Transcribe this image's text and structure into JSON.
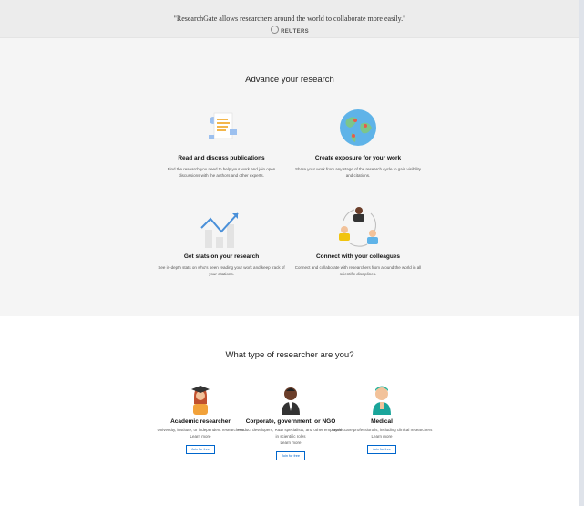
{
  "quote_bar": {
    "quote": "\"ResearchGate allows researchers around the world to collaborate more easily.\"",
    "source": "REUTERS"
  },
  "advance": {
    "title": "Advance your research",
    "features": [
      {
        "title": "Read and discuss publications",
        "desc": "Find the research you need to help your work and join open discussions with the authors and other experts.",
        "icon": "document-icon"
      },
      {
        "title": "Create exposure for your work",
        "desc": "Share your work from any stage of the research cycle to gain visibility and citations.",
        "icon": "globe-icon"
      },
      {
        "title": "Get stats on your research",
        "desc": "See in-depth stats on who's been reading your work and keep track of your citations.",
        "icon": "stats-icon"
      },
      {
        "title": "Connect with your colleagues",
        "desc": "Connect and collaborate with researchers from around the world in all scientific disciplines.",
        "icon": "people-icon"
      }
    ]
  },
  "researcher_types": {
    "title": "What type of researcher are you?",
    "types": [
      {
        "title": "Academic researcher",
        "desc": "University, institute, or independent researchers",
        "learn_more": "Learn more",
        "join": "Join for free"
      },
      {
        "title": "Corporate, government, or NGO",
        "desc": "Product developers, R&D specialists, and other employees in scientific roles",
        "learn_more": "Learn more",
        "join": "Join for free"
      },
      {
        "title": "Medical",
        "desc": "Health care professionals, including clinical researchers",
        "learn_more": "Learn more",
        "join": "Join for free"
      }
    ]
  },
  "colors": {
    "accent": "#0066cc",
    "teal": "#1aa59a"
  }
}
